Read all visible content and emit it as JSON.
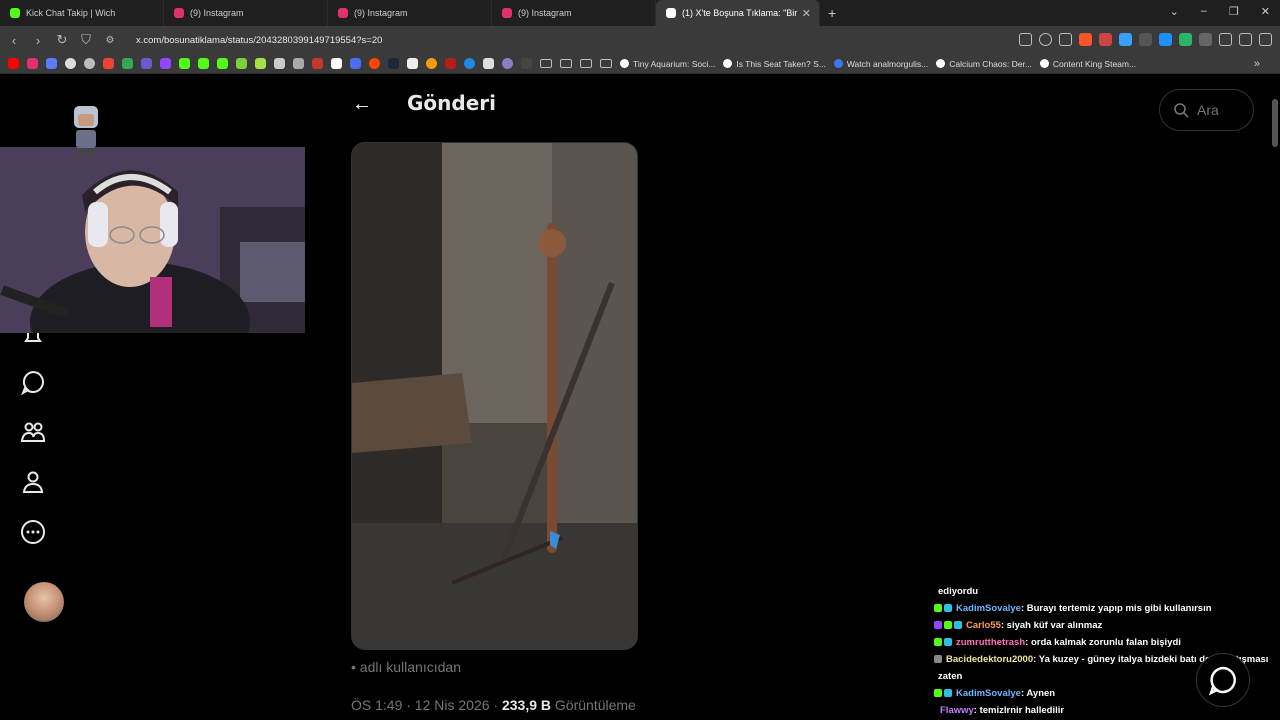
{
  "tabs": [
    {
      "label": "Kick Chat Takip | Wich",
      "color": "#53fc18",
      "active": false
    },
    {
      "label": "(9) Instagram",
      "color": "#e1306c",
      "active": false
    },
    {
      "label": "(9) Instagram",
      "color": "#e1306c",
      "active": false
    },
    {
      "label": "(9) Instagram",
      "color": "#e1306c",
      "active": false
    },
    {
      "label": "(1) X'te Boşuna Tıklama: \"Bir",
      "color": "#ffffff",
      "active": true
    }
  ],
  "address": {
    "url": "x.com/bosunatiklama/status/2043280399149719554?s=20"
  },
  "bookmarks": [
    {
      "label": "Tiny Aquarium: Soci..."
    },
    {
      "label": "Is This Seat Taken? S..."
    },
    {
      "label": "Watch analmorgulis..."
    },
    {
      "label": "Calcium Chaos: Der..."
    },
    {
      "label": "Content King Steam..."
    }
  ],
  "post": {
    "title": "Gönderi",
    "caption": "adlı kullanıcıdan",
    "time": "ÖS 1:49 · 12 Nis 2026 ·",
    "views": "233,9 B",
    "views_label": "Görüntüleme"
  },
  "search": {
    "placeholder": "Ara"
  },
  "chat": {
    "partial": "ediyordu",
    "messages": [
      {
        "user": "KadimSovalye",
        "color": "#6cb7ff",
        "text": ": Burayı tertemiz yapıp mis gibi kullanırsın"
      },
      {
        "user": "Carlo55",
        "color": "#ff9f4a",
        "text": ": siyah küf var alınmaz"
      },
      {
        "user": "zumrutthetrash",
        "color": "#ff6fb5",
        "text": ": orda kalmak zorunlu falan bişiydi"
      },
      {
        "user": "Bacidedektoru2000",
        "color": "#f2e39b",
        "text": ": Ya kuzey - güney italya bizdeki batı doğu çatışması"
      },
      {
        "user": "",
        "color": "#ffffff",
        "text": "zaten"
      },
      {
        "user": "KadimSovalye",
        "color": "#6cb7ff",
        "text": ": Aynen"
      },
      {
        "user": "Flawwy",
        "color": "#c57cff",
        "text": ": temizlrnir halledilir"
      }
    ]
  }
}
